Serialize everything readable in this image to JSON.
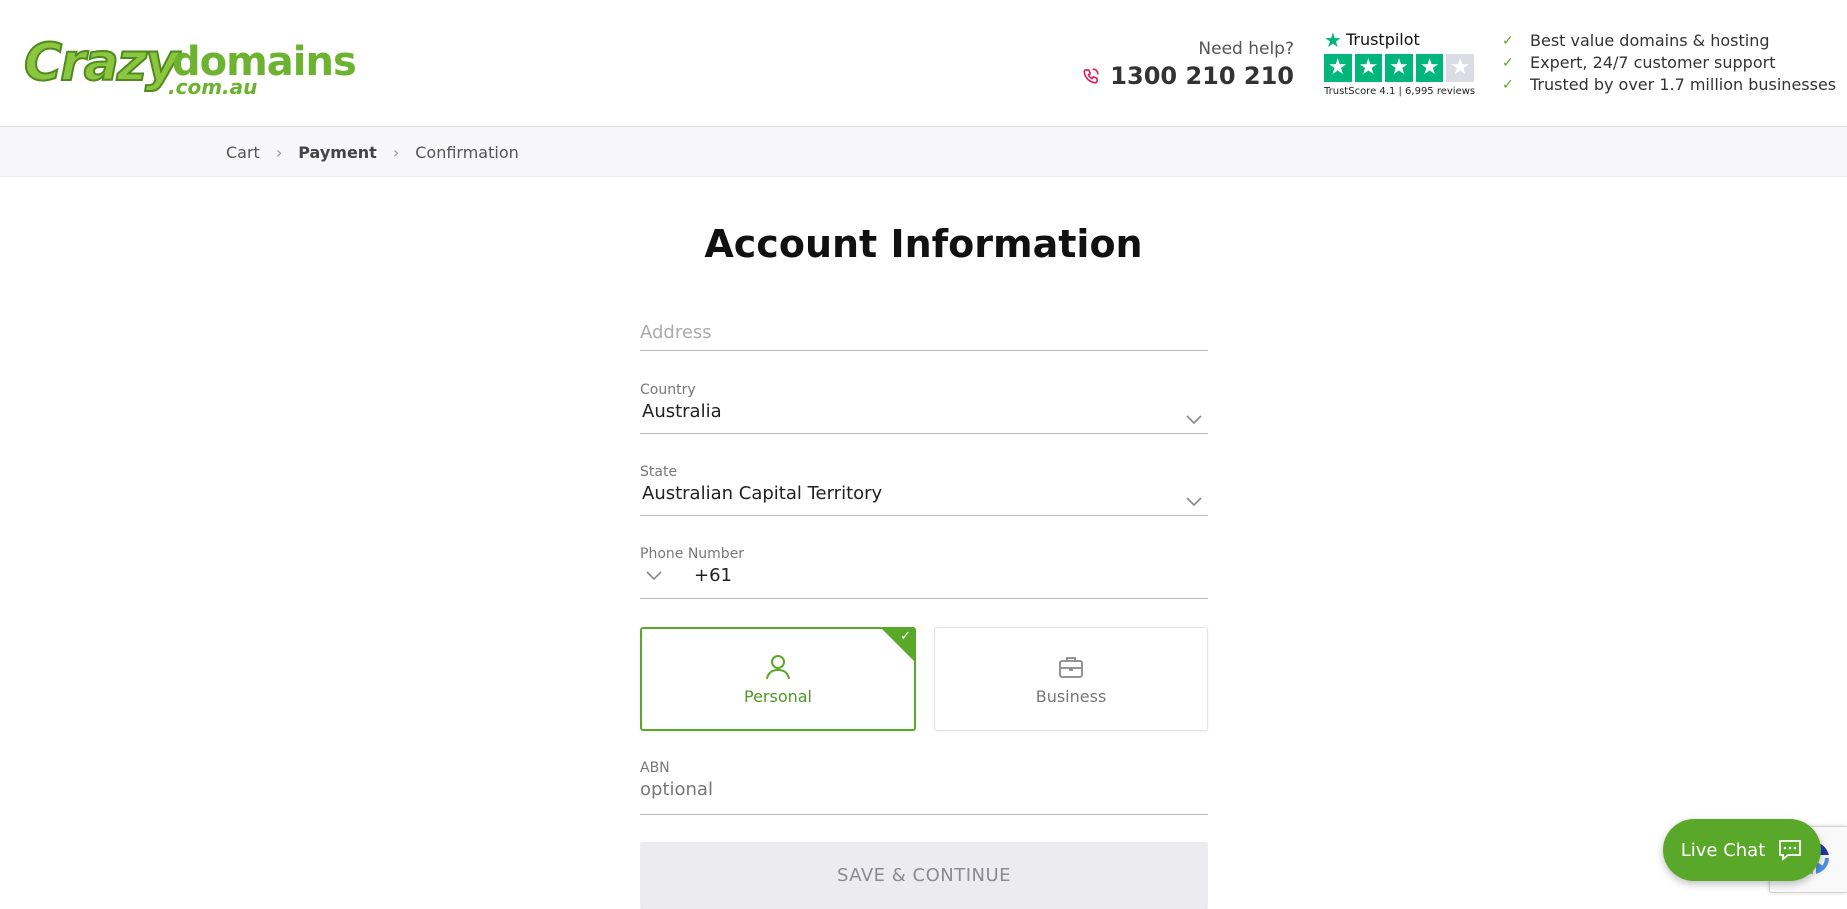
{
  "header": {
    "logo": {
      "part1": "Crazy",
      "part2": "domains",
      "part3": ".com.au"
    },
    "help_label": "Need help?",
    "phone": "1300 210 210",
    "trustpilot": {
      "brand": "Trustpilot",
      "rating": 4.1,
      "stars_filled": 4,
      "stars_total": 5,
      "score_text": "TrustScore 4.1 | 6,995 reviews",
      "color": "#00b67a"
    },
    "benefits": [
      "Best value domains & hosting",
      "Expert, 24/7 customer support",
      "Trusted by over 1.7 million businesses"
    ]
  },
  "breadcrumb": {
    "items": [
      "Cart",
      "Payment",
      "Confirmation"
    ],
    "active": "Payment"
  },
  "form": {
    "title": "Account Information",
    "address": {
      "placeholder": "Address",
      "value": ""
    },
    "country": {
      "label": "Country",
      "value": "Australia"
    },
    "state": {
      "label": "State",
      "value": "Australian Capital Territory"
    },
    "phone": {
      "label": "Phone Number",
      "code": "+61"
    },
    "account_type": {
      "options": [
        "Personal",
        "Business"
      ],
      "selected": "Personal"
    },
    "abn": {
      "label": "ABN",
      "placeholder": "optional"
    },
    "submit_label": "SAVE & CONTINUE"
  },
  "chat": {
    "label": "Live Chat"
  },
  "colors": {
    "brand_green": "#5aa82a",
    "phone_icon": "#e0245e",
    "disabled_button": "#ececf0"
  },
  "icons": {
    "phone": "phone-icon",
    "check": "check-icon",
    "chevron": "chevron-down-icon",
    "personal": "user-icon",
    "business": "briefcase-icon",
    "chat": "chat-bubble-icon"
  }
}
